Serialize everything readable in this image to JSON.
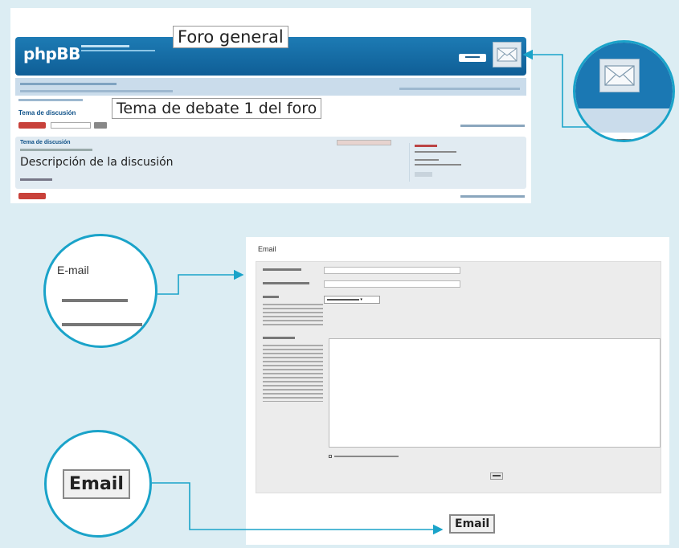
{
  "colors": {
    "background": "#dcedf3",
    "accent_teal": "#1aa3c9",
    "phpbb_blue": "#1477b0"
  },
  "forum": {
    "logo_text": "phpBB",
    "forum_title": "Foro general",
    "topic_title": "Tema de debate 1 del foro",
    "topic_heading": "Tema de discusión",
    "post_title": "Tema de discusión",
    "post_description": "Descripción de la discusión",
    "mail_icon": "envelope-icon"
  },
  "zoom_mail": {
    "mail_icon": "envelope-icon"
  },
  "email_form": {
    "title": "Email",
    "send_label": "Email"
  },
  "zoom_email_label": {
    "title": "E-mail"
  },
  "zoom_email_button": {
    "label": "Email"
  }
}
